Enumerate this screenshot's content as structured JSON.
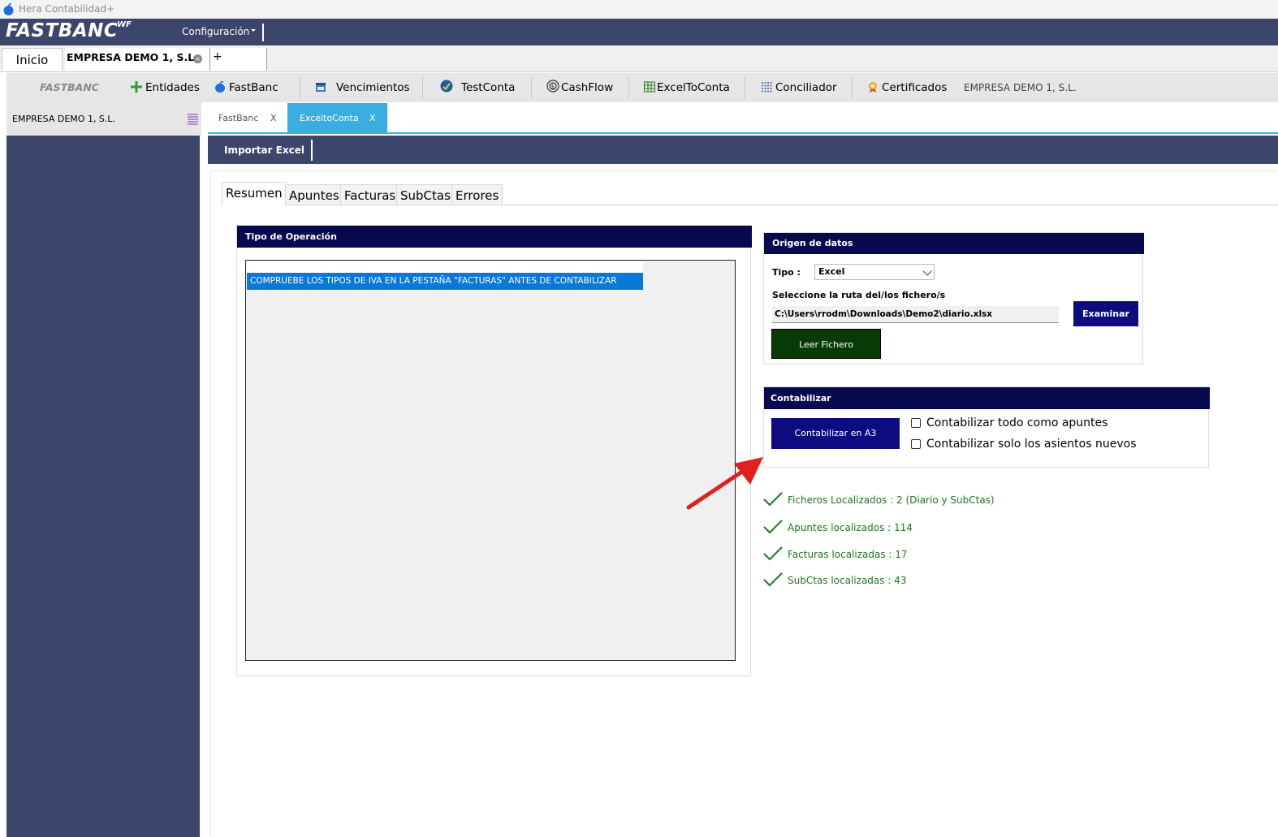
{
  "window": {
    "title": "Hera Contabilidad+"
  },
  "brandbar": {
    "brand": "FASTBANC",
    "brand_sup": "WF",
    "menu_config": "Configuración"
  },
  "doc_tabs": {
    "inicio": "Inicio",
    "empresa": "EMPRESA DEMO 1, S.L.",
    "plus": "+"
  },
  "modules": {
    "fastbanc_label": "FASTBANC",
    "entidades": "Entidades",
    "fastbanc": "FastBanc",
    "vencimientos": "Vencimientos",
    "testconta": "TestConta",
    "cashflow": "CashFlow",
    "exceltoconta": "ExcelToConta",
    "conciliador": "Conciliador",
    "certificados": "Certificados",
    "empresa": "EMPRESA DEMO 1, S.L."
  },
  "sidebar": {
    "empresa": "EMPRESA DEMO 1, S.L."
  },
  "inner_tabs": {
    "fastbanc": "FastBanc",
    "fastbanc_close": "X",
    "excel": "ExceltoConta",
    "excel_close": "X"
  },
  "importar": {
    "label": "Importar Excel"
  },
  "subtabs": {
    "resumen": "Resumen",
    "apuntes": "Apuntes",
    "facturas": "Facturas",
    "subctas": "SubCtas",
    "errores": "Errores"
  },
  "tipo_operacion": {
    "title": "Tipo de Operación",
    "selected_row": "COMPRUEBE LOS TIPOS DE IVA EN LA PESTAÑA \"FACTURAS\" ANTES DE CONTABILIZAR"
  },
  "origen": {
    "title": "Origen de datos",
    "tipo_label": "Tipo :",
    "tipo_value": "Excel",
    "ruta_label": "Seleccione la ruta del/los fichero/s",
    "ruta_value": "C:\\Users\\rrodm\\Downloads\\Demo2\\diario.xlsx",
    "examinar": "Examinar",
    "leer": "Leer Fichero"
  },
  "contabilizar": {
    "title": "Contabilizar",
    "button": "Contabilizar en A3",
    "opt_todo": "Contabilizar todo como apuntes",
    "opt_nuevos": "Contabilizar solo los asientos nuevos"
  },
  "status": {
    "ficheros": "Ficheros Localizados : 2  (Diario y SubCtas)",
    "apuntes": "Apuntes localizados : 114",
    "facturas": "Facturas localizadas : 17",
    "subctas": "SubCtas localizadas : 43"
  },
  "colors": {
    "brand_bar": "#3c456b",
    "panel_header": "#070a4f",
    "primary_button": "#0c0c80",
    "read_button": "#063b06",
    "active_tab": "#3aaee0",
    "status_green": "#1a7a1a",
    "selection": "#0a78d6"
  }
}
